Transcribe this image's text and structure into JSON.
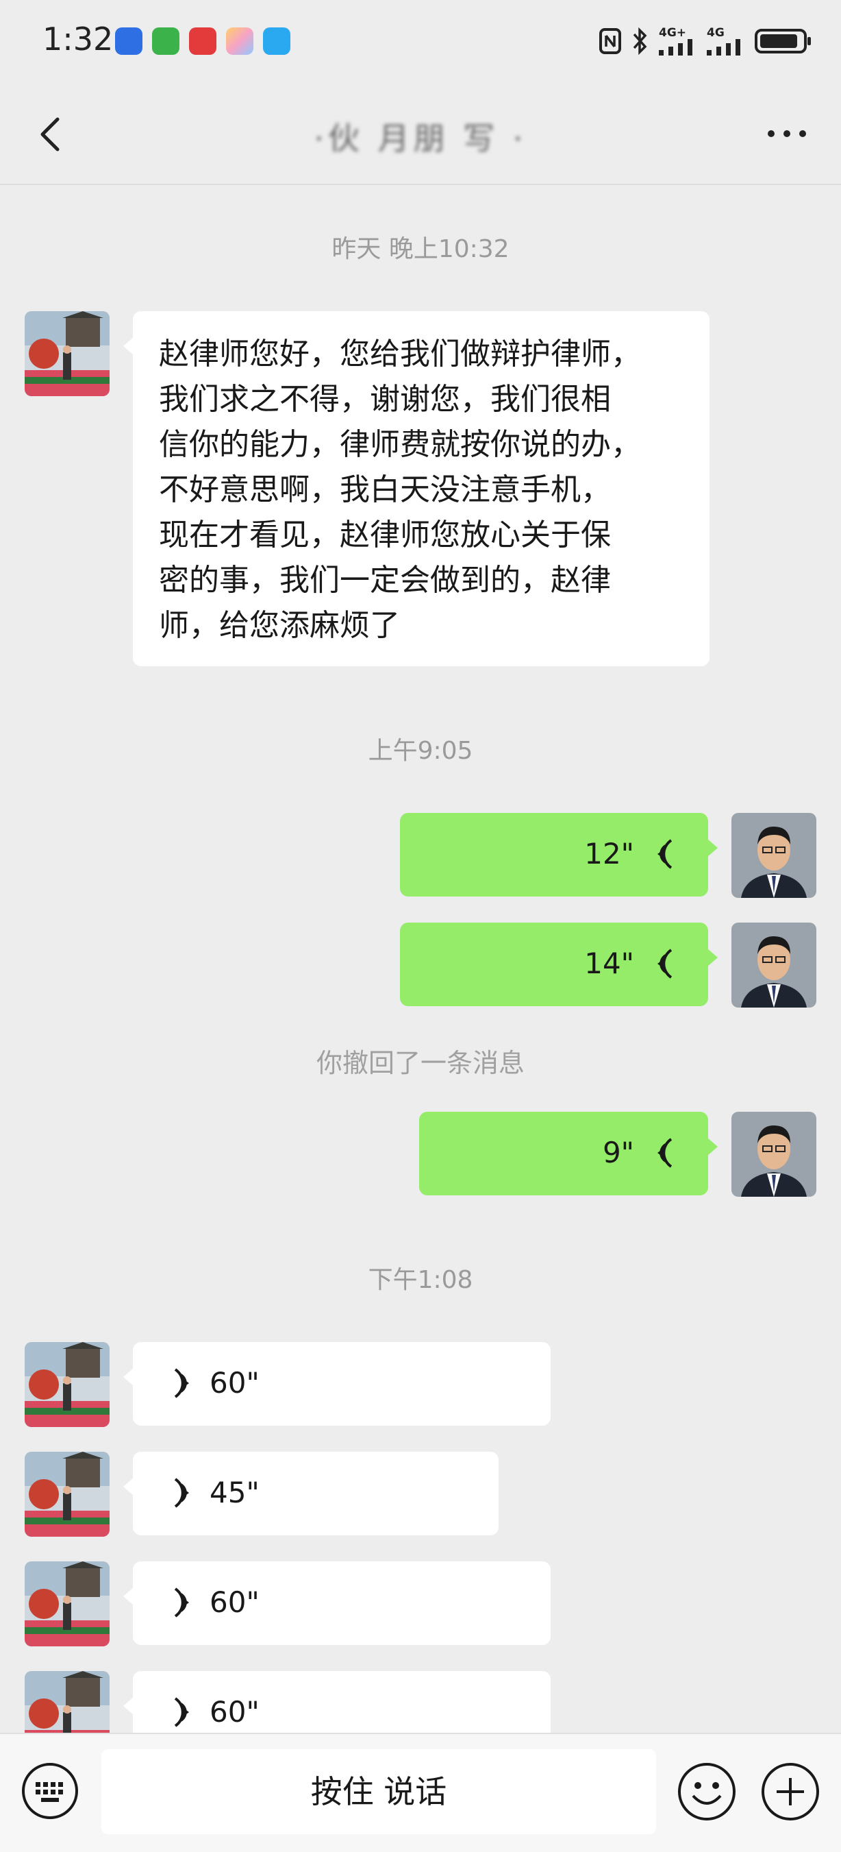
{
  "status_bar": {
    "time": "1:32",
    "network_1": "4G+",
    "network_2": "4G",
    "notification_icons": [
      "bluetooth-app-icon",
      "green-app-icon",
      "red-app-icon",
      "photos-app-icon",
      "search-app-icon"
    ],
    "battery_level": 0.9
  },
  "header": {
    "title": "·伙 月朋 写 ·"
  },
  "colors": {
    "background": "#ededed",
    "bubble_out": "#95ec69",
    "bubble_in": "#ffffff",
    "timestamp": "#9a9a9a"
  },
  "messages": {
    "ts1": "昨天 晚上10:32",
    "text1": "赵律师您好，您给我们做辩护律师，\n我们求之不得，谢谢您，我们很相\n信你的能力，律师费就按你说的办，\n不好意思啊，我白天没注意手机，\n现在才看见，赵律师您放心关于保\n密的事，我们一定会做到的，赵律\n师，给您添麻烦了",
    "ts2": "上午9:05",
    "out_voice_1": "12\"",
    "out_voice_2": "14\"",
    "recall": "你撤回了一条消息",
    "out_voice_3": "9\"",
    "ts3": "下午1:08",
    "in_voice_1": "60\"",
    "in_voice_2": "45\"",
    "in_voice_3": "60\"",
    "in_voice_4": "60\""
  },
  "input_bar": {
    "hold_to_talk": "按住 说话"
  }
}
